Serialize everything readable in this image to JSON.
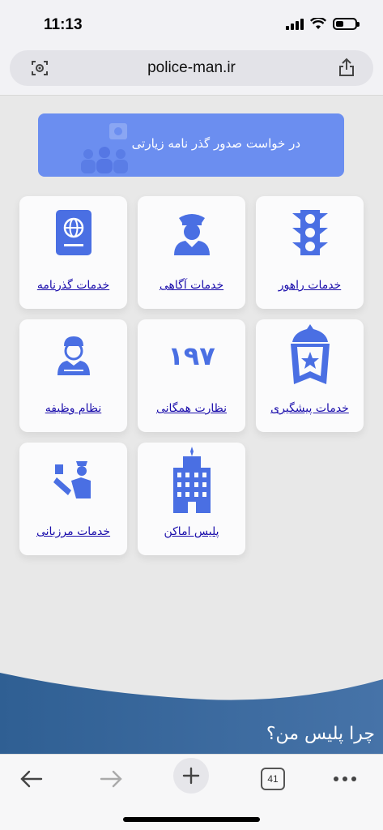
{
  "status_bar": {
    "time": "11:13"
  },
  "browser": {
    "url": "police-man.ir",
    "open_tabs": "41"
  },
  "banner": {
    "text": "در خواست صدور گذر نامه زیارتی"
  },
  "services": [
    {
      "label": "خدمات راهور",
      "icon": "traffic-light-icon"
    },
    {
      "label": "خدمات آگاهی",
      "icon": "police-officer-icon"
    },
    {
      "label": "خدمات گذرنامه",
      "icon": "passport-icon"
    },
    {
      "label": "خدمات پیشگیری",
      "icon": "prevention-emblem-icon"
    },
    {
      "label": "نظارت همگانی",
      "number": "۱۹۷",
      "icon": "number-197-icon"
    },
    {
      "label": "نظام وظیفه",
      "icon": "soldier-icon"
    },
    {
      "label": "پلیس اماکن",
      "icon": "building-icon"
    },
    {
      "label": "خدمات مرزبانی",
      "icon": "border-officer-icon"
    }
  ],
  "section": {
    "heading": "چرا پلیس من؟"
  },
  "colors": {
    "accent": "#4a6fe3",
    "banner": "#6b8ef0",
    "wave": "#3f6ea3",
    "link": "#1a0dab"
  }
}
